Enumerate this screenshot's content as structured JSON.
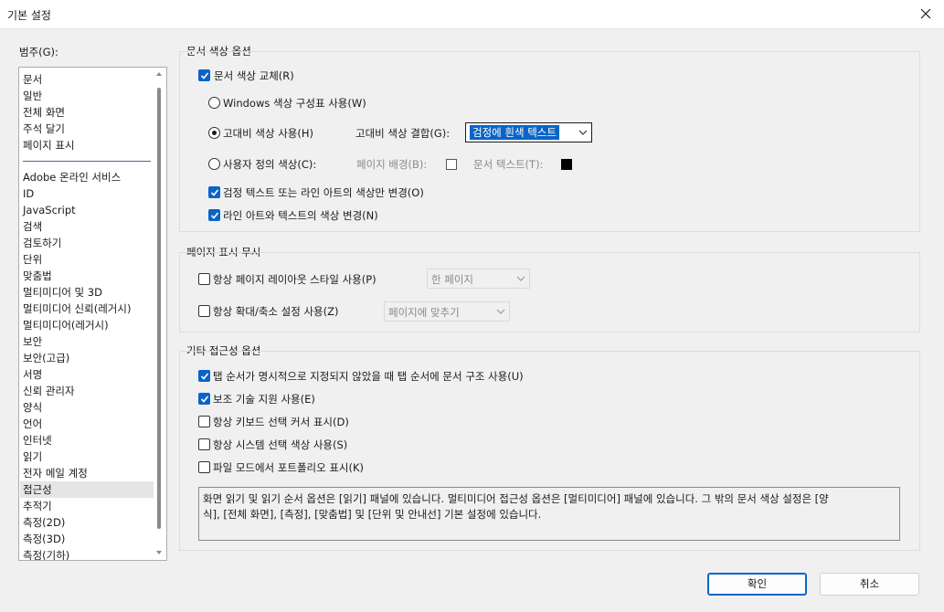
{
  "window": {
    "title": "기본 설정",
    "close_icon": "close-icon"
  },
  "categories": {
    "label": "범주(G):",
    "items_top": [
      "문서",
      "일반",
      "전체 화면",
      "주석 달기",
      "페이지 표시"
    ],
    "items": [
      "Adobe 온라인 서비스",
      "ID",
      "JavaScript",
      "검색",
      "검토하기",
      "단위",
      "맞춤법",
      "멀티미디어 및 3D",
      "멀티미디어 신뢰(레거시)",
      "멀티미디어(레거시)",
      "보안",
      "보안(고급)",
      "서명",
      "신뢰 관리자",
      "양식",
      "언어",
      "인터넷",
      "읽기",
      "전자 메일 계정",
      "접근성",
      "추적기",
      "측정(2D)",
      "측정(3D)",
      "측정(기하)"
    ],
    "selected": "접근성"
  },
  "doc_color": {
    "title": "문서 색상 옵션",
    "replace_label": "문서 색상 교체(R)",
    "replace_checked": true,
    "windows_scheme_label": "Windows 색상 구성표 사용(W)",
    "high_contrast_label": "고대비 색상 사용(H)",
    "high_contrast_selected": true,
    "combo_label": "고대비 색상 결합(G):",
    "combo_value": "검정에 흰색 텍스트",
    "custom_label": "사용자 정의 색상(C):",
    "page_bg_label": "페이지 배경(B):",
    "page_bg_color": "#ffffff",
    "doc_text_label": "문서 텍스트(T):",
    "doc_text_color": "#000000",
    "black_only_label": "검정 텍스트 또는 라인 아트의 색상만 변경(O)",
    "black_only_checked": true,
    "line_art_label": "라인 아트와 텍스트의 색상 변경(N)",
    "line_art_checked": true
  },
  "page_display": {
    "title": "페이지 표시 무시",
    "layout_label": "항상 페이지 레이아웃 스타일 사용(P)",
    "layout_checked": false,
    "layout_value": "한 페이지",
    "zoom_label": "항상 확대/축소 설정 사용(Z)",
    "zoom_checked": false,
    "zoom_value": "페이지에 맞추기"
  },
  "other": {
    "title": "기타 접근성 옵션",
    "items": [
      {
        "label": "탭 순서가 명시적으로 지정되지 않았을 때 탭 순서에 문서 구조 사용(U)",
        "checked": true
      },
      {
        "label": "보조 기술 지원 사용(E)",
        "checked": true
      },
      {
        "label": "항상 키보드 선택 커서 표시(D)",
        "checked": false
      },
      {
        "label": "항상 시스템 선택 색상 사용(S)",
        "checked": false
      },
      {
        "label": "파일 모드에서 포트폴리오 표시(K)",
        "checked": false
      }
    ]
  },
  "description": {
    "line1": "화면 읽기 및 읽기 순서 옵션은 [읽기] 패널에 있습니다. 멀티미디어 접근성 옵션은 [멀티미디어] 패널에 있습니다. 그 밖의 문서 색상 설정은 [양",
    "line2": "식], [전체 화면], [측정], [맞춤법] 및 [단위 및 안내선] 기본 설정에 있습니다."
  },
  "buttons": {
    "ok": "확인",
    "cancel": "취소"
  }
}
